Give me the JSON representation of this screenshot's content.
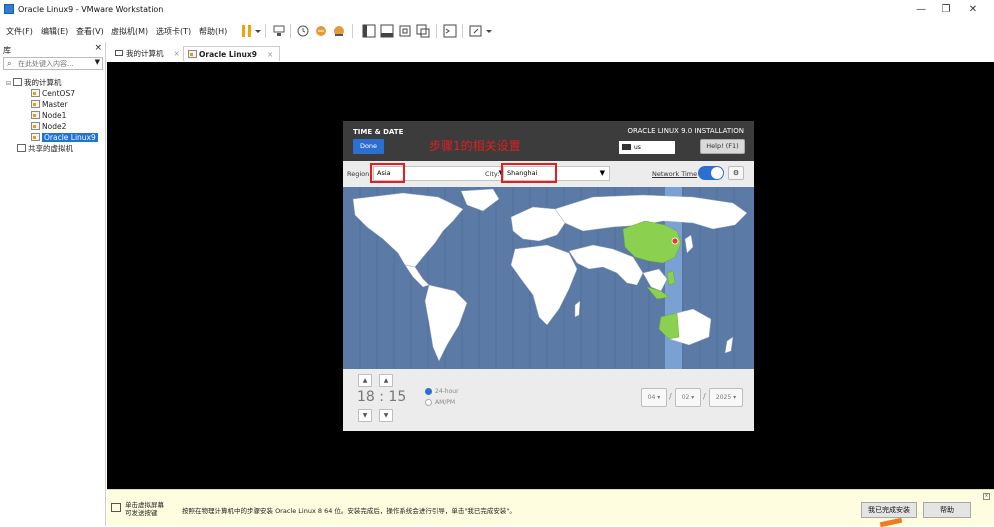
{
  "window": {
    "title": "Oracle Linux9 - VMware Workstation",
    "minimize_glyph": "—",
    "maximize_glyph": "❐",
    "close_glyph": "✕"
  },
  "menu": {
    "items": [
      "文件(F)",
      "编辑(E)",
      "查看(V)",
      "虚拟机(M)",
      "选项卡(T)",
      "帮助(H)"
    ]
  },
  "library": {
    "title": "库",
    "close_glyph": "×",
    "search_placeholder": "在此处键入内容...",
    "my_computer": "我的计算机",
    "vms": [
      "CentOS7",
      "Master",
      "Node1",
      "Node2",
      "Oracle Linux9"
    ],
    "selected_vm": "Oracle Linux9",
    "shared_vms": "共享的虚拟机"
  },
  "tabs": [
    {
      "label": "我的计算机",
      "active": false
    },
    {
      "label": "Oracle Linux9",
      "active": true
    }
  ],
  "installer": {
    "spoke_title": "TIME & DATE",
    "done_label": "Done",
    "product_title": "ORACLE LINUX 9.0 INSTALLATION",
    "keyboard_layout": "us",
    "help_label": "Help! (F1)",
    "annotation": "步骤1的相关设置",
    "region_label": "Region:",
    "region_value": "Asia",
    "city_label": "City:",
    "city_value": "Shanghai",
    "network_time_label": "Network Time",
    "network_time_on": true,
    "time_display": "18 : 15",
    "format_24h": "24-hour",
    "format_ampm": "AM/PM",
    "selected_format": "24-hour",
    "month": "04",
    "day": "02",
    "year": "2025",
    "colors": {
      "header": "#3c3c3c",
      "accent": "#2d6fd0",
      "map_ocean": "#5b7aa6",
      "map_land": "#ffffff",
      "highlight_zone": "#7aa0d4",
      "highlight_country": "#8bd14f",
      "annotation": "#e31e1e"
    }
  },
  "hint_bar": {
    "left_text_line1": "单击虚拟屏幕",
    "left_text_line2": "可发送按键",
    "message": "按照在物理计算机中的步骤安装 Oracle Linux 8 64 位。安装完成后，操作系统会进行引导，单击\"我已完成安装\"。",
    "done_button": "我已完成安装",
    "help_button": "帮助"
  }
}
